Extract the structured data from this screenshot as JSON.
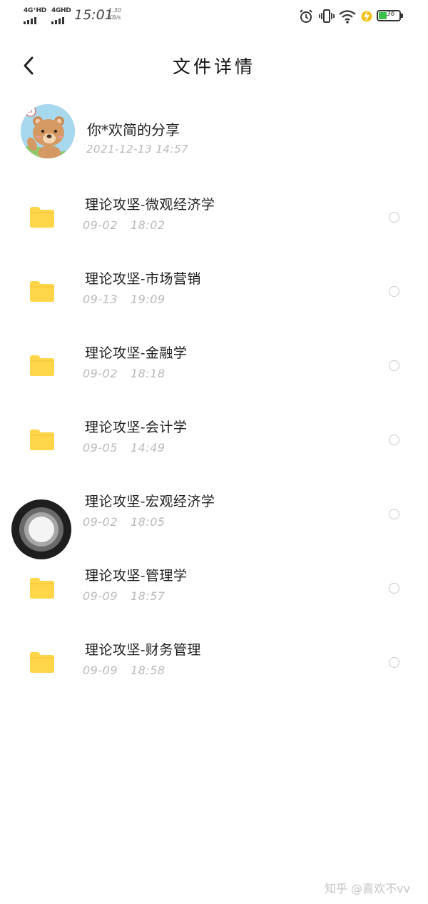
{
  "status_bar": {
    "network_1": "4G⁺HD",
    "network_2": "4GHD",
    "time": "15:01",
    "speed_value": "1.30",
    "speed_unit": "KB/s",
    "battery_level": "36",
    "battery_color": "#3cc04b",
    "charging_color": "#f2c21b"
  },
  "header": {
    "title": "文件详情",
    "back_icon": "chevron-left-icon"
  },
  "sharer": {
    "name": "你*欢简的分享",
    "time": "2021-12-13 14:57",
    "avatar": "cartoon-bear-avatar"
  },
  "files": [
    {
      "name": "理论攻坚-微观经济学",
      "date": "09-02",
      "time": "18:02"
    },
    {
      "name": "理论攻坚-市场营销",
      "date": "09-13",
      "time": "19:09"
    },
    {
      "name": "理论攻坚-金融学",
      "date": "09-02",
      "time": "18:18"
    },
    {
      "name": "理论攻坚-会计学",
      "date": "09-05",
      "time": "14:49"
    },
    {
      "name": "理论攻坚-宏观经济学",
      "date": "09-02",
      "time": "18:05"
    },
    {
      "name": "理论攻坚-管理学",
      "date": "09-09",
      "time": "18:57"
    },
    {
      "name": "理论攻坚-财务管理",
      "date": "09-09",
      "time": "18:58"
    }
  ],
  "folder_color": "#ffd54a",
  "watermark": "知乎 @喜欢不vv"
}
